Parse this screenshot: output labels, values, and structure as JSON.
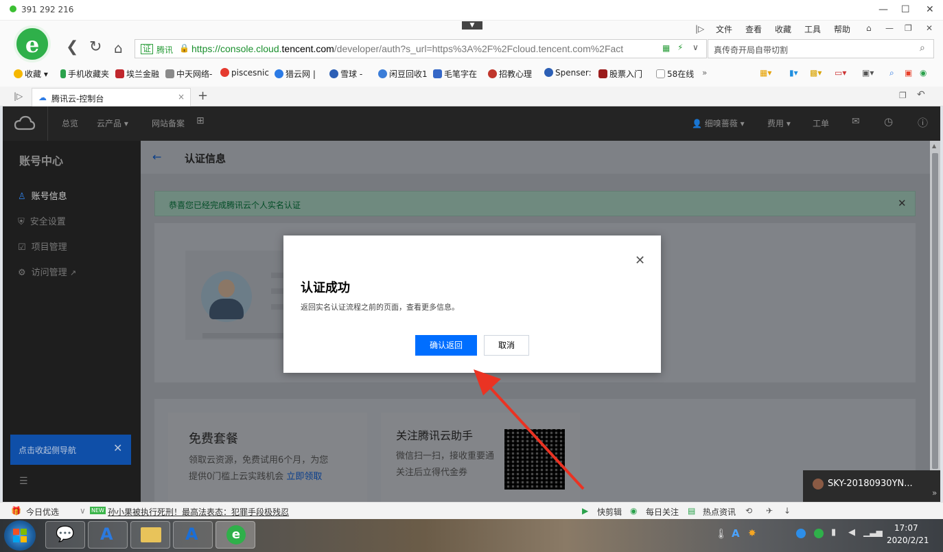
{
  "titlebar": {
    "qq_number": "391 292 216"
  },
  "browser": {
    "menu": [
      "文件",
      "查看",
      "收藏",
      "工具",
      "帮助"
    ],
    "url_site_badge": "腾讯",
    "url_prefix": "https://console.cloud.",
    "url_domain": "tencent.com",
    "url_rest": "/developer/auth?s_url=https%3A%2F%2Fcloud.tencent.com%2Fact",
    "search_placeholder": "真传奇开局自带切割",
    "bookmarks": [
      "收藏",
      "手机收藏夹",
      "埃兰金融",
      "中天网络-",
      "piscesnic",
      "猎云网 |",
      "雪球 -",
      "闲豆回收1",
      "毛笔字在",
      "招教心理",
      "Spenser:",
      "股票入门",
      "58在线"
    ],
    "tab_title": "腾讯云-控制台"
  },
  "console": {
    "topnav": {
      "overview": "总览",
      "products": "云产品",
      "beian": "网站备案",
      "user": "细嗅蔷薇",
      "billing": "费用",
      "tickets": "工单"
    },
    "sidebar": {
      "title": "账号中心",
      "items": [
        "账号信息",
        "安全设置",
        "项目管理",
        "访问管理"
      ],
      "collapse_tip": "点击收起侧导航"
    },
    "page_title": "认证信息",
    "success_banner": "恭喜您已经完成腾讯云个人实名认证",
    "free_card": {
      "title": "免费套餐",
      "line1": "领取云资源，免费试用6个月，为您",
      "line2": "提供0门槛上云实践机会",
      "link": "立即领取"
    },
    "follow_card": {
      "title": "关注腾讯云助手",
      "line1": "微信扫一扫，接收重要通",
      "line2": "关注后立得代金券"
    }
  },
  "modal": {
    "title": "认证成功",
    "body": "返回实名认证流程之前的页面，查看更多信息。",
    "confirm": "确认返回",
    "cancel": "取消"
  },
  "statusbar": {
    "today": "今日优选",
    "news_badge": "NEW",
    "headline": "孙小果被执行死刑！最高法表态：犯罪手段极残忍",
    "right": [
      "快剪辑",
      "每日关注",
      "热点资讯"
    ]
  },
  "notification": {
    "device": "SKY-20180930YN..."
  },
  "taskbar": {
    "time": "17:07",
    "date": "2020/2/21"
  },
  "colors": {
    "primary": "#006eff",
    "success_bg": "#e8f7ef",
    "success_text": "#0abf5b",
    "annotation_arrow": "#ea3323"
  }
}
